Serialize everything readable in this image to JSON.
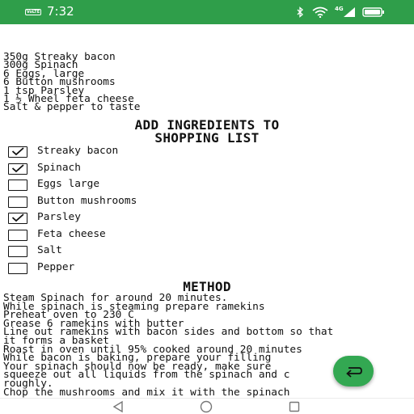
{
  "status_bar": {
    "volte": "VoLTE",
    "time": "7:32",
    "network": "4G",
    "icons": [
      "bluetooth-icon",
      "wifi-icon",
      "signal-icon",
      "battery-icon"
    ],
    "background": "#2f9e4a"
  },
  "ingredients": [
    "350g Streaky bacon",
    "300g Spinach",
    "6 Eggs, large",
    "6 Button mushrooms",
    "1 tsp Parsley",
    "1 ½ Wheel feta cheese",
    "Salt & pepper to taste"
  ],
  "shopping": {
    "title_line1": "ADD INGREDIENTS TO",
    "title_line2": "SHOPPING LIST",
    "items": [
      {
        "label": "Streaky bacon",
        "checked": true
      },
      {
        "label": "Spinach",
        "checked": true
      },
      {
        "label": "Eggs large",
        "checked": false
      },
      {
        "label": "Button mushrooms",
        "checked": false
      },
      {
        "label": "Parsley",
        "checked": true
      },
      {
        "label": "Feta cheese",
        "checked": false
      },
      {
        "label": "Salt",
        "checked": false
      },
      {
        "label": "Pepper",
        "checked": false
      }
    ]
  },
  "method": {
    "title": "METHOD",
    "steps": [
      "Steam Spinach for around 20 minutes.",
      "While spinach is steaming prepare ramekins",
      "Preheat oven to 230 C",
      "Grease 6 ramekins with butter",
      "Line out ramekins with bacon sides and bottom so that",
      "it forms a basket",
      "Roast in oven until 95% cooked around 20 minutes",
      "While bacon is baking, prepare your filling",
      "Your spinach should now be ready, make sure",
      "squeeze out all liquids from the spinach and c",
      "roughly.",
      "Chop the mushrooms and mix it with the spinach"
    ]
  },
  "fab": {
    "icon": "return-arrow-icon",
    "color": "#33a852"
  },
  "nav": {
    "icons": [
      "back-triangle-icon",
      "home-circle-icon",
      "recents-square-icon"
    ]
  }
}
